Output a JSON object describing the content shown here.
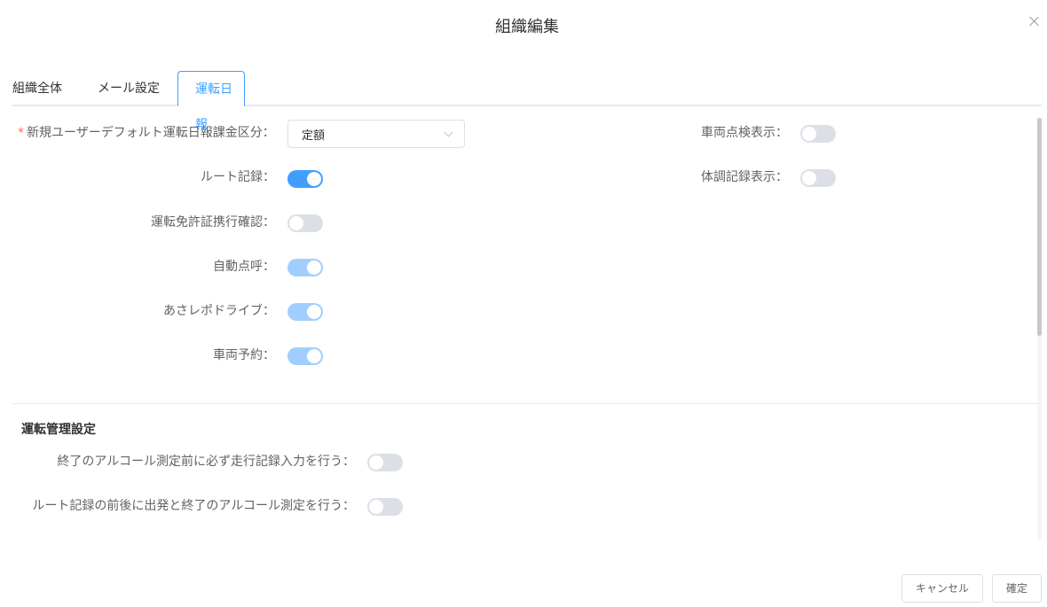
{
  "dialog": {
    "title": "組織編集"
  },
  "tabs": [
    {
      "label": "組織全体"
    },
    {
      "label": "メール設定"
    },
    {
      "label": "運転日報"
    }
  ],
  "form": {
    "billing": {
      "required_mark": "*",
      "label": "新規ユーザーデフォルト運転日報課金区分：",
      "selected": "定額"
    },
    "route_record": {
      "label": "ルート記録：",
      "on": true
    },
    "license_check": {
      "label": "運転免許証携行確認：",
      "on": false
    },
    "auto_rollcall": {
      "label": "自動点呼：",
      "on": true
    },
    "asa_repo_drive": {
      "label": "あさレポドライブ：",
      "on": true
    },
    "vehicle_booking": {
      "label": "車両予約：",
      "on": true
    },
    "vehicle_inspection": {
      "label": "車両点検表示：",
      "on": false
    },
    "health_record": {
      "label": "体調記録表示：",
      "on": false
    }
  },
  "management": {
    "title": "運転管理設定",
    "items": [
      {
        "label": "終了のアルコール測定前に必ず走行記録入力を行う：",
        "on": false
      },
      {
        "label": "ルート記録の前後に出発と終了のアルコール測定を行う：",
        "on": false
      }
    ]
  },
  "footer": {
    "cancel_label": "キャンセル",
    "ok_label": "確定"
  },
  "colors": {
    "accent": "#409eff",
    "accent_light": "#a0cfff",
    "switch_off": "#dcdfe6",
    "required": "#f56c6c"
  }
}
